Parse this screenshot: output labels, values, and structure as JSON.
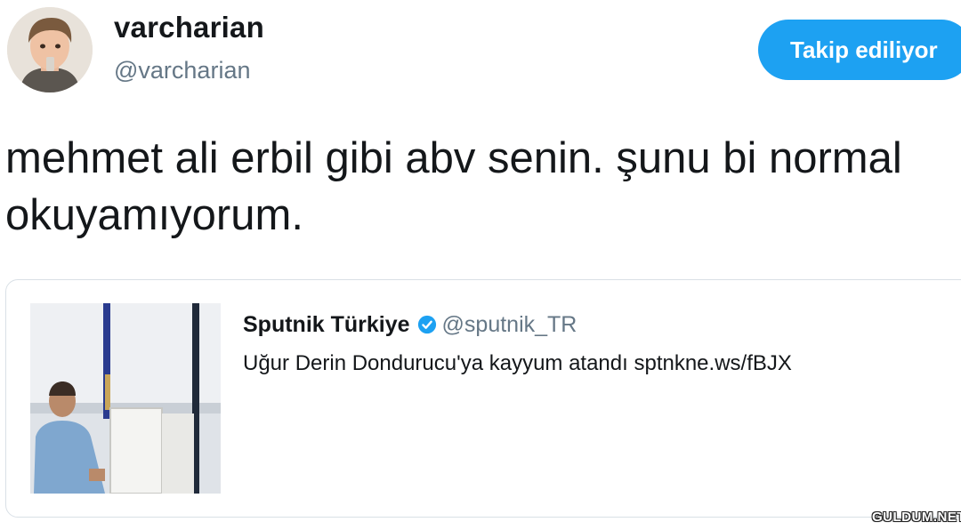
{
  "author": {
    "display_name": "varcharian",
    "handle": "@varcharian"
  },
  "follow_button": {
    "label": "Takip ediliyor",
    "color": "#1da1f2"
  },
  "tweet": {
    "text": "mehmet ali erbil gibi abv senin. şunu bi normal okuyamıyorum."
  },
  "quoted_tweet": {
    "display_name": "Sputnik Türkiye",
    "verified": true,
    "verified_icon": "verified-badge-icon",
    "handle": "@sputnik_TR",
    "text": "Uğur Derin Dondurucu'ya kayyum atandı sptnkne.ws/fBJX"
  },
  "watermark": {
    "text": "GULDUM.NET"
  },
  "colors": {
    "text_primary": "#14171a",
    "text_secondary": "#657786",
    "border": "#d9e0e6",
    "accent": "#1da1f2"
  }
}
